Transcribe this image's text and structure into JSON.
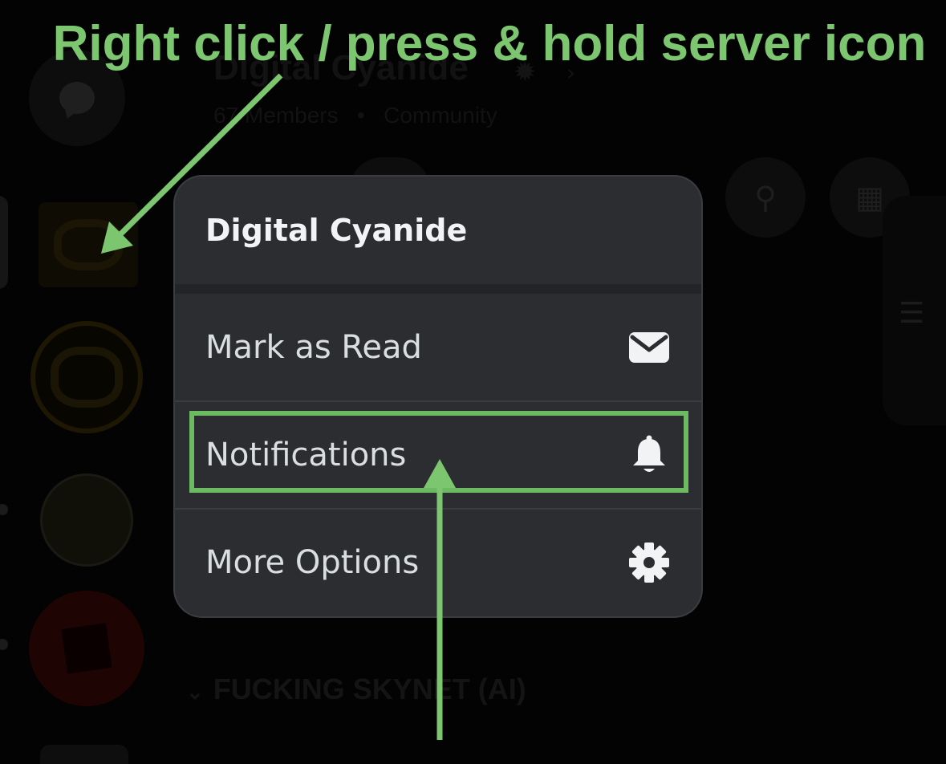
{
  "annotation": {
    "instruction": "Right click / press & hold server icon",
    "color": "#7dc670"
  },
  "background": {
    "server_name": "Digital Cyanide",
    "members": "67 Members",
    "meta_separator": "•",
    "meta_tail": "Community",
    "category": "FUCKING SKYNET (AI)"
  },
  "context_menu": {
    "title": "Digital Cyanide",
    "items": [
      {
        "label": "Mark as Read",
        "icon": "envelope-icon"
      },
      {
        "label": "Notifications",
        "icon": "bell-icon"
      },
      {
        "label": "More Options",
        "icon": "gear-icon"
      }
    ]
  },
  "colors": {
    "menu_bg": "#2b2d31",
    "menu_text": "#dbdee1",
    "highlight": "#6cbb63"
  }
}
